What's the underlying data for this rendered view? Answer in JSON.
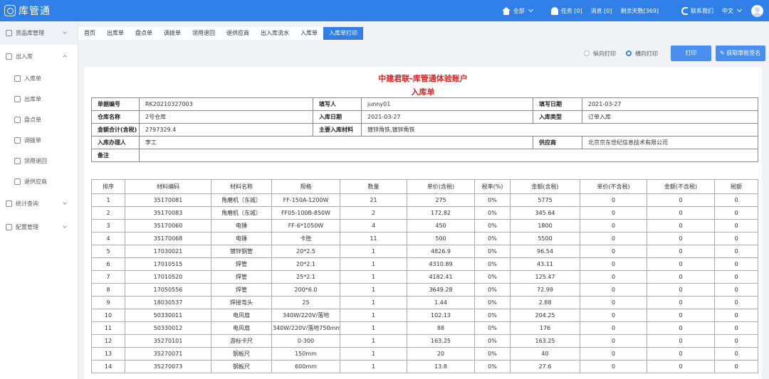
{
  "app": {
    "name": "库管通"
  },
  "topbar": {
    "scope": "全部",
    "tasks": "任务 [0]",
    "messages": "消息 [0]",
    "days_left": "剩余天数[369]",
    "contact": "联系我们",
    "language": "中文"
  },
  "sidebar": {
    "items": [
      {
        "label": "货品库管理"
      },
      {
        "label": "出入库"
      },
      {
        "label": "入库单"
      },
      {
        "label": "出库单"
      },
      {
        "label": "盘点单"
      },
      {
        "label": "调拨单"
      },
      {
        "label": "领用退回"
      },
      {
        "label": "退供应商"
      },
      {
        "label": "统计查询"
      },
      {
        "label": "配置管理"
      }
    ]
  },
  "tabs": [
    "首页",
    "出库单",
    "盘点单",
    "调拨单",
    "领用退回",
    "退供应商",
    "出入库流水",
    "入库单",
    "入库单打印"
  ],
  "toolbar": {
    "portrait": "纵向打印",
    "landscape": "横向打印",
    "print": "打印",
    "fetch_signature": "获取审批签名"
  },
  "document": {
    "org": "中建君联-库管通体验账户",
    "title": "入库单",
    "info": {
      "doc_no_label": "单据编号",
      "doc_no": "RK20210327003",
      "filler_label": "填写人",
      "filler": "junny01",
      "fill_date_label": "填写日期",
      "fill_date": "2021-03-27",
      "warehouse_label": "仓库名称",
      "warehouse": "2号仓库",
      "in_date_label": "入库日期",
      "in_date": "2021-03-27",
      "in_type_label": "入库类型",
      "in_type": "订单入库",
      "amount_label": "金额合计(含税)",
      "amount": "2797329.4",
      "main_material_label": "主要入库材料",
      "main_material": "镀锌角铁,镀锌角铁",
      "handler_label": "入库办理人",
      "handler": "李工",
      "supplier_label": "供应商",
      "supplier": "北京京东世纪信息技术有限公司",
      "remark_label": "备注",
      "remark": ""
    },
    "columns": [
      "排序",
      "材料编码",
      "材料名称",
      "规格",
      "数量",
      "单价(含税)",
      "税率(%)",
      "金额(含税)",
      "单价(不含税)",
      "金额(不含税)",
      "税额"
    ],
    "rows": [
      [
        "1",
        "35170081",
        "角磨机（东城）",
        "FF-150A-1200W",
        "21",
        "275",
        "0%",
        "5775",
        "0",
        "0",
        "0"
      ],
      [
        "2",
        "35170083",
        "角磨机（东城）",
        "FF05-100B-850W",
        "2",
        "172.82",
        "0%",
        "345.64",
        "0",
        "0",
        "0"
      ],
      [
        "3",
        "35170060",
        "电锤",
        "FF-6*1050W",
        "4",
        "450",
        "0%",
        "1800",
        "0",
        "0",
        "0"
      ],
      [
        "4",
        "35170068",
        "电锤",
        "卡胜",
        "11",
        "500",
        "0%",
        "5500",
        "0",
        "0",
        "0"
      ],
      [
        "5",
        "17030021",
        "镀锌钢管",
        "20*2.5",
        "1",
        "4826.9",
        "0%",
        "96.54",
        "0",
        "0",
        "0"
      ],
      [
        "6",
        "17010515",
        "焊管",
        "20*2.1",
        "1",
        "4310.89",
        "0%",
        "43.11",
        "0",
        "0",
        "0"
      ],
      [
        "7",
        "17010520",
        "焊管",
        "25*2.1",
        "1",
        "4182.41",
        "0%",
        "125.47",
        "0",
        "0",
        "0"
      ],
      [
        "8",
        "17050556",
        "焊管",
        "200*6.0",
        "1",
        "3649.28",
        "0%",
        "72.99",
        "0",
        "0",
        "0"
      ],
      [
        "9",
        "18030537",
        "焊接弯头",
        "25",
        "1",
        "1.44",
        "0%",
        "2.88",
        "0",
        "0",
        "0"
      ],
      [
        "10",
        "50330011",
        "电风扇",
        "340W/220V/落地",
        "1",
        "102.13",
        "0%",
        "204.25",
        "0",
        "0",
        "0"
      ],
      [
        "11",
        "50330012",
        "电风扇",
        "340W/220V/落地750mm",
        "1",
        "88",
        "0%",
        "176",
        "0",
        "0",
        "0"
      ],
      [
        "12",
        "35270101",
        "游标卡尺",
        "0-300",
        "1",
        "163.25",
        "0%",
        "163.25",
        "0",
        "0",
        "0"
      ],
      [
        "13",
        "35270071",
        "钢板尺",
        "150mm",
        "1",
        "20",
        "0%",
        "40",
        "0",
        "0",
        "0"
      ],
      [
        "14",
        "35270073",
        "钢板尺",
        "600mm",
        "1",
        "13.8",
        "0%",
        "27.6",
        "0",
        "0",
        "0"
      ]
    ]
  }
}
